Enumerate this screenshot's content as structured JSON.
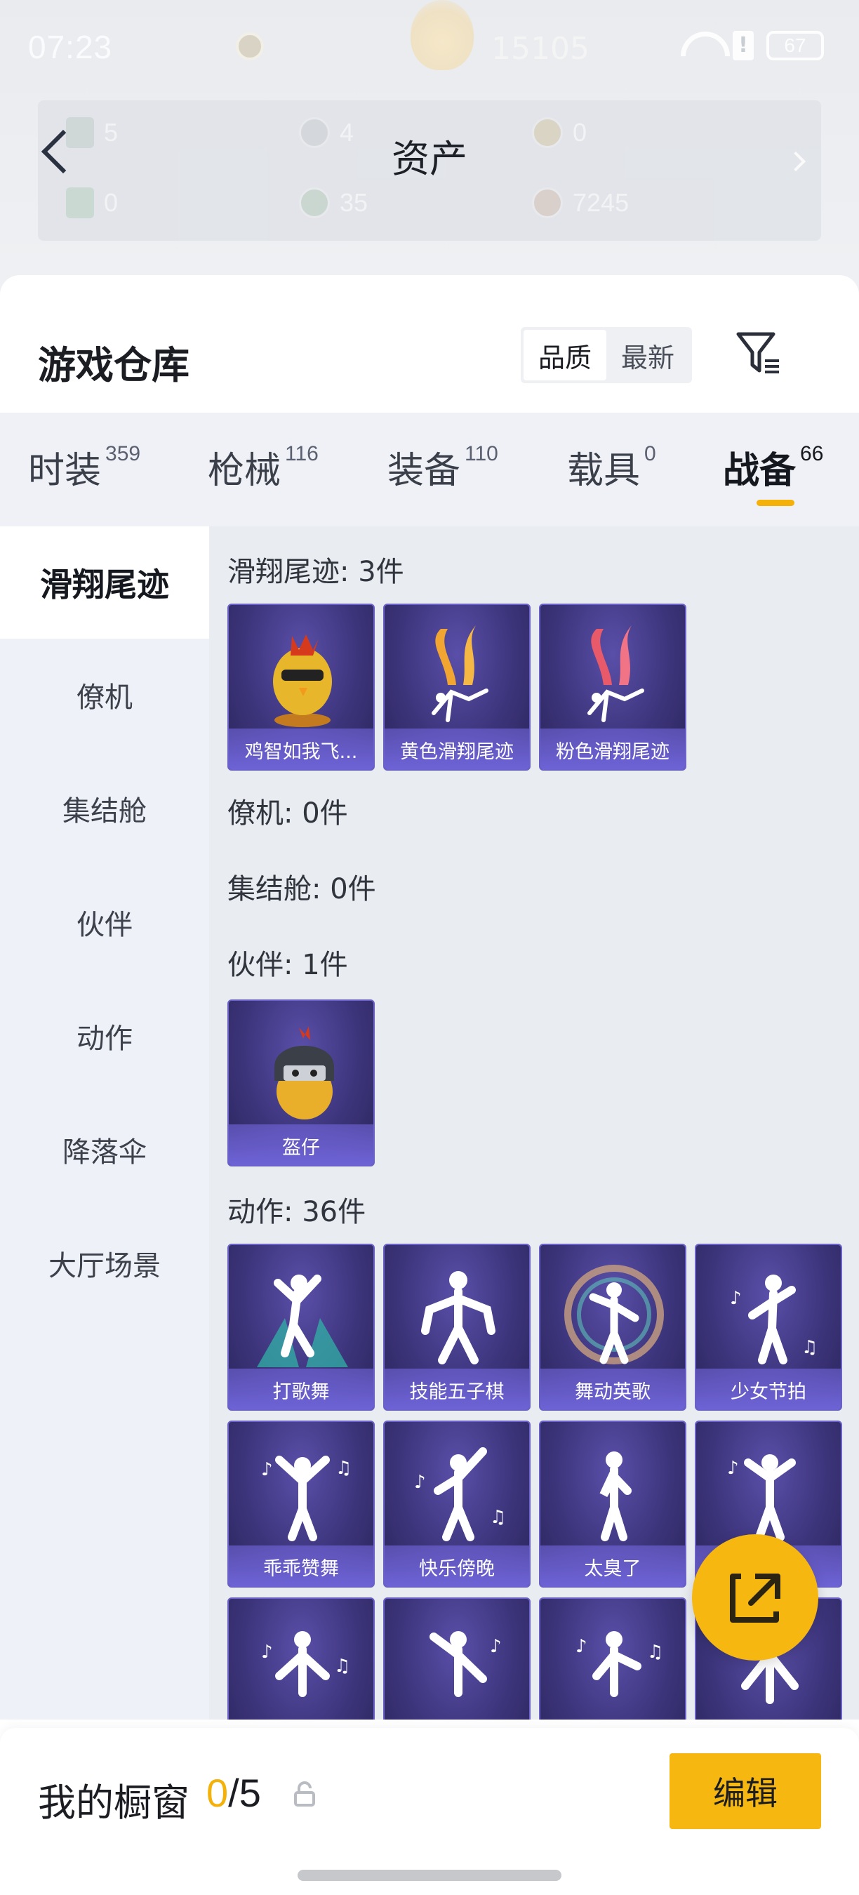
{
  "status_bar": {
    "time": "07:23",
    "blurred_center_text": "15105",
    "battery_level": "67"
  },
  "header": {
    "title": "资产",
    "assets": [
      {
        "icon": "ticket-icon",
        "value": "5"
      },
      {
        "icon": "coin-icon",
        "value": "4"
      },
      {
        "icon": "badge-icon",
        "value": "0"
      },
      {
        "icon": "card-icon",
        "value": "0"
      },
      {
        "icon": "gem-icon",
        "value": "35"
      },
      {
        "icon": "bp-coin-icon",
        "value": "7245"
      }
    ]
  },
  "warehouse": {
    "title": "游戏仓库",
    "sort_options": [
      "品质",
      "最新"
    ],
    "active_sort": "品质"
  },
  "categories": [
    {
      "name": "时装",
      "count": "359"
    },
    {
      "name": "枪械",
      "count": "116"
    },
    {
      "name": "装备",
      "count": "110"
    },
    {
      "name": "载具",
      "count": "0"
    },
    {
      "name": "战备",
      "count": "66",
      "active": true
    }
  ],
  "side_nav": [
    "滑翔尾迹",
    "僚机",
    "集结舱",
    "伙伴",
    "动作",
    "降落伞",
    "大厅场景"
  ],
  "sections": {
    "glide_trail": {
      "title": "滑翔尾迹: 3件",
      "items": [
        "鸡智如我飞...",
        "黄色滑翔尾迹",
        "粉色滑翔尾迹"
      ]
    },
    "wingman": {
      "title": "僚机: 0件"
    },
    "pod": {
      "title": "集结舱: 0件"
    },
    "companion": {
      "title": "伙伴: 1件",
      "items": [
        "盔仔"
      ]
    },
    "emote": {
      "title": "动作: 36件",
      "items": [
        "打歌舞",
        "技能五子棋",
        "舞动英歌",
        "少女节拍",
        "乖乖赞舞",
        "快乐傍晚",
        "太臭了",
        ""
      ]
    }
  },
  "showcase": {
    "title": "我的橱窗",
    "used": "0",
    "total": "/5",
    "edit_label": "编辑"
  },
  "colors": {
    "accent": "#f7b711",
    "card_bg": "#3d357c",
    "card_stripe": "#6e63d6"
  }
}
